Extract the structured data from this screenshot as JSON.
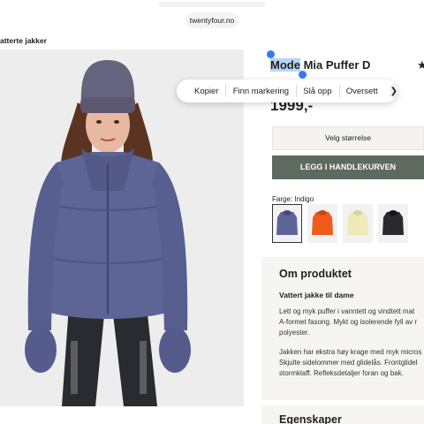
{
  "browser": {
    "url": "twentyfour.no"
  },
  "breadcrumb": "atterte jakker",
  "product": {
    "title_selected": "Mode",
    "title_rest": " Mia Puffer D",
    "price": "1999,-",
    "size_select_label": "Velg størrelse",
    "add_to_cart_label": "LEGG I HANDLEKURVEN",
    "color_label": "Farge: Indigo",
    "swatches": [
      {
        "color": "#5d6596",
        "selected": true
      },
      {
        "color": "#f05a1c",
        "selected": false
      },
      {
        "color": "#efeab8",
        "selected": false
      },
      {
        "color": "#2a2a2c",
        "selected": false
      }
    ]
  },
  "context_menu": {
    "items": [
      "Kopier",
      "Finn markering",
      "Slå opp",
      "Oversett"
    ],
    "next_icon": "chevron-right-icon"
  },
  "about": {
    "title": "Om produktet",
    "subtitle": "Vattert jakke til dame",
    "paragraph1": [
      "Lett og myk puffer i vanntett og vindtett mat",
      "A-formet fasong. Mykt og isolerende fyll av r",
      "polyester."
    ],
    "paragraph2": [
      "Jakken har ekstra høy krage med myk micros",
      "Skjulte sidelommer med glidelås. Frontglidel",
      "stormklaff. Refleksdetaljer foran og bak."
    ]
  },
  "specs": {
    "title": "Egenskaper"
  },
  "colors": {
    "cart_button": "#5e695f",
    "selection": "#b8d4f6",
    "handle": "#2f7df6",
    "jacket": "#5d6596"
  }
}
